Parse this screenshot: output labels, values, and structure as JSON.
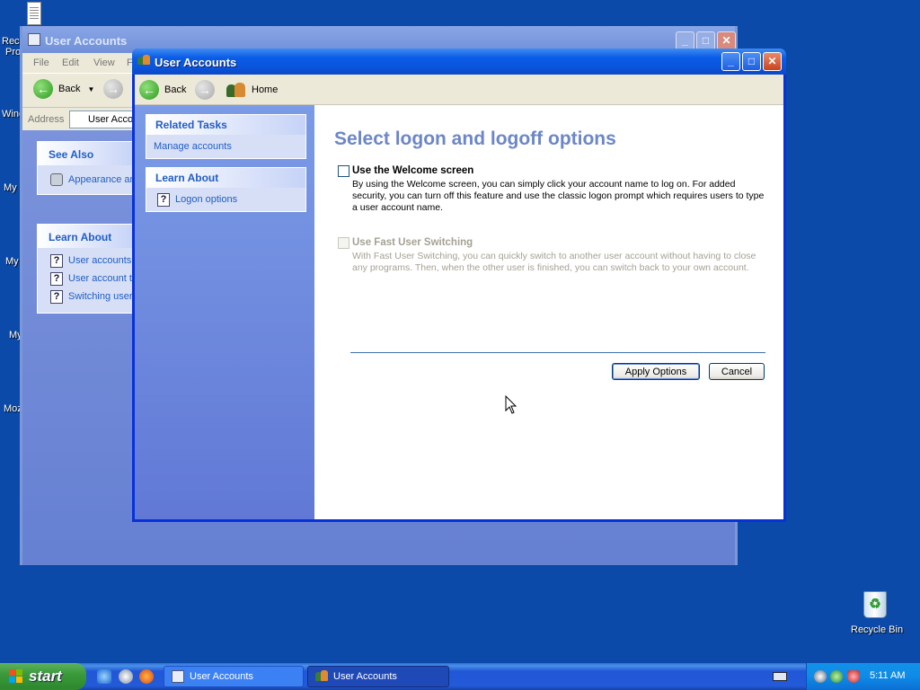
{
  "colors": {
    "desktop": "#0b4aa8",
    "title_bar": "#0a5ce6",
    "task_link": "#215dc6",
    "heading": "#6c86c8"
  },
  "desktop": {
    "icons": {
      "top_doc_cut_1": "Rec",
      "top_doc_cut_2": "Pro",
      "cut_3": "Winc",
      "cut_4": "My I",
      "cut_5": "My",
      "cut_6": "My",
      "cut_7": "Moz",
      "recycle_bin": "Recycle Bin"
    }
  },
  "background_window": {
    "title": "User Accounts",
    "menu": [
      "File",
      "Edit",
      "View",
      "F"
    ],
    "back_label": "Back",
    "address_label": "Address",
    "address_value": "User Accou",
    "see_also": {
      "heading": "See Also",
      "items": [
        "Appearance an"
      ]
    },
    "learn_about": {
      "heading": "Learn About",
      "items": [
        "User accounts",
        "User account ty",
        "Switching users"
      ]
    }
  },
  "window": {
    "title": "User Accounts",
    "toolbar": {
      "back": "Back",
      "home": "Home"
    },
    "related_tasks": {
      "heading": "Related Tasks",
      "items": [
        "Manage accounts"
      ]
    },
    "learn_about": {
      "heading": "Learn About",
      "items": [
        "Logon options"
      ]
    },
    "main": {
      "heading": "Select logon and logoff options",
      "welcome": {
        "label": "Use the Welcome screen",
        "checked": false,
        "enabled": true,
        "description": "By using the Welcome screen, you can simply click your account name to log on. For added security, you can turn off this feature and use the classic logon prompt which requires users to type a user account name."
      },
      "fast_switching": {
        "label": "Use Fast User Switching",
        "checked": false,
        "enabled": false,
        "description": "With Fast User Switching, you can quickly switch to another user account without having to close any programs. Then, when the other user is finished, you can switch back to your own account."
      },
      "apply_button": "Apply Options",
      "cancel_button": "Cancel"
    }
  },
  "taskbar": {
    "start": "start",
    "tasks": [
      "User Accounts",
      "User Accounts"
    ],
    "clock": "5:11 AM"
  }
}
